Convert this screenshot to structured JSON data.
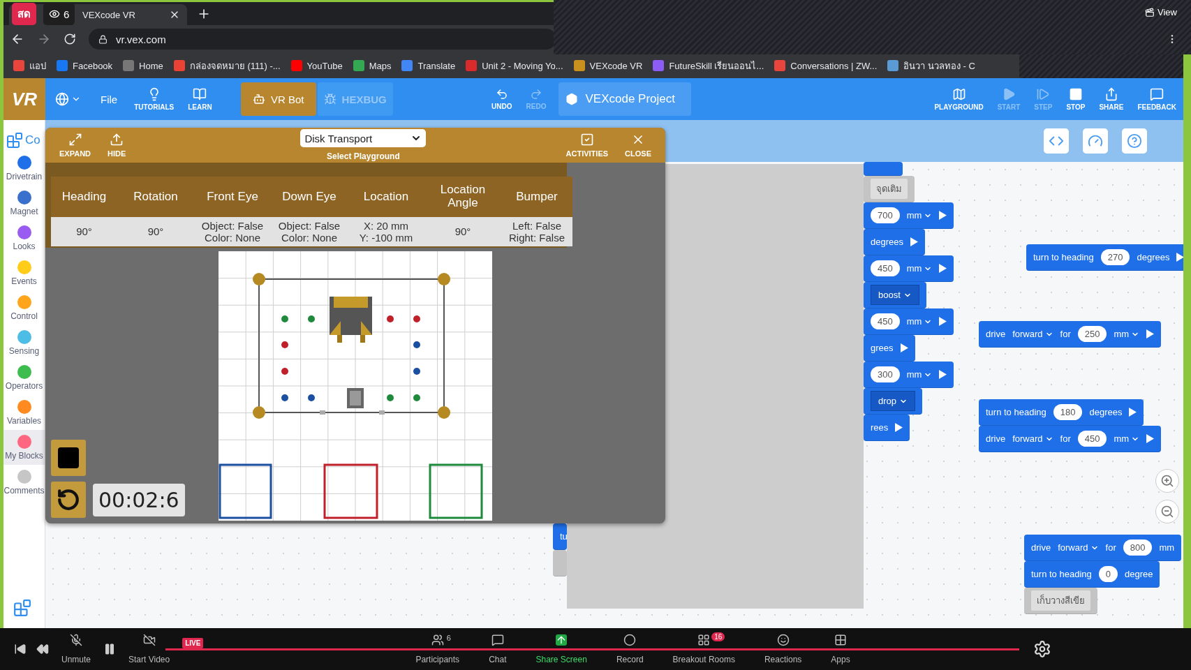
{
  "live_badge": {
    "label": "สด",
    "viewers": "6"
  },
  "browser": {
    "tab": {
      "title": "VEXcode VR"
    },
    "address": "vr.vex.com",
    "bookmarks": [
      {
        "label": "แอป",
        "color": "#e8453c"
      },
      {
        "label": "Facebook",
        "color": "#1877f2"
      },
      {
        "label": "Home",
        "color": "#777777"
      },
      {
        "label": "กล่องจดหมาย (111) -...",
        "color": "#ea4335"
      },
      {
        "label": "YouTube",
        "color": "#ff0000"
      },
      {
        "label": "Maps",
        "color": "#34a853"
      },
      {
        "label": "Translate",
        "color": "#4285f4"
      },
      {
        "label": "Unit 2 - Moving Yo...",
        "color": "#d92b2b"
      },
      {
        "label": "VEXcode VR",
        "color": "#c8901e"
      },
      {
        "label": "FutureSkill เรียนออนไ...",
        "color": "#8b5cf6"
      },
      {
        "label": "Conversations | ZW...",
        "color": "#e8453c"
      },
      {
        "label": "อินวา นวลทอง - C",
        "color": "#5b9bd5"
      }
    ]
  },
  "share_overlay": {
    "view_label": "View"
  },
  "toolbar": {
    "logo": "VR",
    "file": "File",
    "nav": [
      {
        "kind": "tutorials",
        "label": "TUTORIALS"
      },
      {
        "kind": "learn",
        "label": "LEARN"
      }
    ],
    "robots": [
      {
        "kind": "vrbot",
        "label": "VR Bot",
        "selected": true
      },
      {
        "kind": "hexbug",
        "label": "HEXBUG",
        "selected": false
      }
    ],
    "history": [
      {
        "kind": "undo",
        "label": "UNDO",
        "disabled": false
      },
      {
        "kind": "redo",
        "label": "REDO",
        "disabled": true
      }
    ],
    "project": "VEXcode Project",
    "actions": [
      {
        "kind": "playground",
        "label": "PLAYGROUND",
        "disabled": false
      },
      {
        "kind": "start",
        "label": "START",
        "disabled": true
      },
      {
        "kind": "step",
        "label": "STEP",
        "disabled": true
      },
      {
        "kind": "stop",
        "label": "STOP",
        "disabled": false
      },
      {
        "kind": "share",
        "label": "SHARE",
        "disabled": false
      },
      {
        "kind": "feedback",
        "label": "FEEDBACK",
        "disabled": false
      }
    ]
  },
  "sidebar": {
    "header": "Co",
    "categories": [
      {
        "label": "Drivetrain",
        "color": "#1f6fe8",
        "selected": false
      },
      {
        "label": "Magnet",
        "color": "#3a70cc",
        "selected": false
      },
      {
        "label": "Looks",
        "color": "#9a5cf0",
        "selected": false
      },
      {
        "label": "Events",
        "color": "#ffcc1a",
        "selected": false
      },
      {
        "label": "Control",
        "color": "#ffa51c",
        "selected": false
      },
      {
        "label": "Sensing",
        "color": "#4dbde6",
        "selected": false
      },
      {
        "label": "Operators",
        "color": "#3dbd4f",
        "selected": false
      },
      {
        "label": "Variables",
        "color": "#ff8a1f",
        "selected": false
      },
      {
        "label": "My Blocks",
        "color": "#ff6680",
        "selected": true
      },
      {
        "label": "Comments",
        "color": "#c6c6c6",
        "selected": false
      }
    ]
  },
  "playground": {
    "left_buttons": [
      {
        "kind": "expand",
        "label": "EXPAND"
      },
      {
        "kind": "hide",
        "label": "HIDE"
      }
    ],
    "select": {
      "value": "Disk Transport",
      "caption": "Select Playground"
    },
    "right_buttons": [
      {
        "kind": "activities",
        "label": "ACTIVITIES"
      },
      {
        "kind": "close",
        "label": "CLOSE"
      }
    ],
    "table": {
      "columns": [
        "Heading",
        "Rotation",
        "Front Eye",
        "Down Eye",
        "Location",
        "Location Angle",
        "Bumper"
      ],
      "row": [
        [
          "90°"
        ],
        [
          "90°"
        ],
        [
          "Object: False",
          "Color: None"
        ],
        [
          "Object: False",
          "Color: None"
        ],
        [
          "X: 20 mm",
          "Y: -100 mm"
        ],
        [
          "90°"
        ],
        [
          "Left: False",
          "Right: False"
        ]
      ]
    },
    "timer": "00:02:6"
  },
  "workspace": {
    "stacks": [
      {
        "blocks": [
          {
            "kind": "drivetrain"
          },
          {
            "kind": "comment",
            "parts": [
              {
                "kind": "text",
                "text": "จุดเติม"
              }
            ]
          },
          {
            "kind": "drivetrain",
            "parts": [
              {
                "kind": "input",
                "text": "700"
              },
              {
                "kind": "dropdown",
                "text": "mm"
              },
              {
                "kind": "run"
              }
            ]
          },
          {
            "kind": "drivetrain",
            "parts": [
              {
                "kind": "text",
                "text": "degrees"
              },
              {
                "kind": "run"
              }
            ]
          },
          {
            "kind": "drivetrain",
            "parts": [
              {
                "kind": "input",
                "text": "450"
              },
              {
                "kind": "dropdown",
                "text": "mm"
              },
              {
                "kind": "run"
              }
            ]
          },
          {
            "kind": "drivetrain",
            "parts": [
              {
                "kind": "menu",
                "text": "boost"
              }
            ]
          },
          {
            "kind": "drivetrain",
            "parts": [
              {
                "kind": "input",
                "text": "450"
              },
              {
                "kind": "dropdown",
                "text": "mm"
              },
              {
                "kind": "run"
              }
            ]
          },
          {
            "kind": "drivetrain",
            "parts": [
              {
                "kind": "text",
                "text": "grees"
              },
              {
                "kind": "run"
              }
            ]
          },
          {
            "kind": "drivetrain",
            "parts": [
              {
                "kind": "input",
                "text": "300"
              },
              {
                "kind": "dropdown",
                "text": "mm"
              },
              {
                "kind": "run"
              }
            ]
          },
          {
            "kind": "drivetrain",
            "parts": [
              {
                "kind": "menu",
                "text": "drop"
              }
            ]
          },
          {
            "kind": "drivetrain",
            "parts": [
              {
                "kind": "text",
                "text": "rees"
              },
              {
                "kind": "run"
              }
            ]
          }
        ]
      },
      {
        "blocks": [
          {
            "kind": "drivetrain",
            "parts": [
              {
                "kind": "text",
                "text": "tu"
              }
            ]
          },
          {
            "kind": "comment"
          }
        ]
      },
      {
        "blocks": [
          {
            "kind": "drivetrain",
            "parts": [
              {
                "kind": "text",
                "text": "turn to heading"
              },
              {
                "kind": "input",
                "text": "270"
              },
              {
                "kind": "text",
                "text": "degrees"
              },
              {
                "kind": "run"
              }
            ]
          }
        ]
      },
      {
        "blocks": [
          {
            "kind": "drivetrain",
            "parts": [
              {
                "kind": "text",
                "text": "drive"
              },
              {
                "kind": "dropdown",
                "text": "forward"
              },
              {
                "kind": "text",
                "text": "for"
              },
              {
                "kind": "input",
                "text": "250"
              },
              {
                "kind": "dropdown",
                "text": "mm"
              },
              {
                "kind": "run"
              }
            ]
          }
        ]
      },
      {
        "blocks": [
          {
            "kind": "drivetrain",
            "parts": [
              {
                "kind": "text",
                "text": "turn to heading"
              },
              {
                "kind": "input",
                "text": "180"
              },
              {
                "kind": "text",
                "text": "degrees"
              },
              {
                "kind": "run"
              }
            ]
          },
          {
            "kind": "drivetrain",
            "parts": [
              {
                "kind": "text",
                "text": "drive"
              },
              {
                "kind": "dropdown",
                "text": "forward"
              },
              {
                "kind": "text",
                "text": "for"
              },
              {
                "kind": "input",
                "text": "450"
              },
              {
                "kind": "dropdown",
                "text": "mm"
              },
              {
                "kind": "run"
              }
            ]
          }
        ]
      },
      {
        "blocks": [
          {
            "kind": "drivetrain",
            "parts": [
              {
                "kind": "text",
                "text": "drive"
              },
              {
                "kind": "dropdown",
                "text": "forward"
              },
              {
                "kind": "text",
                "text": "for"
              },
              {
                "kind": "input",
                "text": "800"
              },
              {
                "kind": "text",
                "text": "mm"
              }
            ]
          },
          {
            "kind": "drivetrain",
            "parts": [
              {
                "kind": "text",
                "text": "turn to heading"
              },
              {
                "kind": "input",
                "text": "0"
              },
              {
                "kind": "text",
                "text": "degree"
              }
            ]
          },
          {
            "kind": "comment",
            "parts": [
              {
                "kind": "text",
                "text": "เก็บวางสีเขีย"
              }
            ]
          }
        ]
      }
    ]
  },
  "meeting_bar": {
    "left": [
      {
        "kind": "mic",
        "label": "Unmute"
      },
      {
        "kind": "video",
        "label": "Start Video"
      }
    ],
    "live": "LIVE",
    "center": [
      {
        "kind": "participants",
        "label": "Participants",
        "count": "6"
      },
      {
        "kind": "chat",
        "label": "Chat"
      },
      {
        "kind": "share",
        "label": "Share Screen"
      },
      {
        "kind": "record",
        "label": "Record"
      },
      {
        "kind": "breakout",
        "label": "Breakout Rooms",
        "count": "16"
      },
      {
        "kind": "reactions",
        "label": "Reactions"
      },
      {
        "kind": "apps",
        "label": "Apps"
      }
    ]
  }
}
